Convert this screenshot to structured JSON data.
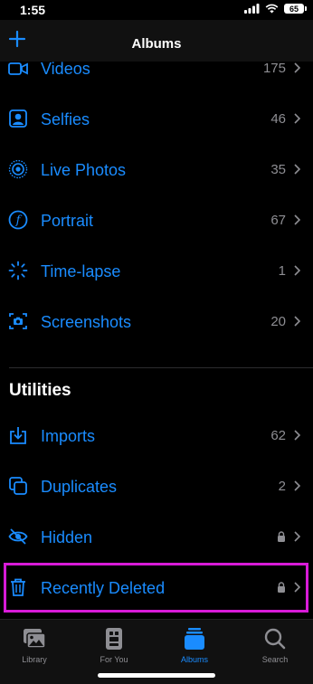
{
  "status": {
    "time": "1:55",
    "battery": "65"
  },
  "nav": {
    "title": "Albums"
  },
  "media_types": [
    {
      "label": "Videos",
      "count": "175",
      "icon": "video-icon"
    },
    {
      "label": "Selfies",
      "count": "46",
      "icon": "selfie-icon"
    },
    {
      "label": "Live Photos",
      "count": "35",
      "icon": "live-photo-icon"
    },
    {
      "label": "Portrait",
      "count": "67",
      "icon": "portrait-icon"
    },
    {
      "label": "Time-lapse",
      "count": "1",
      "icon": "timelapse-icon"
    },
    {
      "label": "Screenshots",
      "count": "20",
      "icon": "screenshot-icon"
    }
  ],
  "utilities": {
    "title": "Utilities",
    "items": [
      {
        "label": "Imports",
        "count": "62",
        "icon": "import-icon"
      },
      {
        "label": "Duplicates",
        "count": "2",
        "icon": "duplicates-icon"
      },
      {
        "label": "Hidden",
        "locked": true,
        "icon": "hidden-icon"
      },
      {
        "label": "Recently Deleted",
        "locked": true,
        "icon": "trash-icon"
      }
    ]
  },
  "tabs": [
    {
      "label": "Library",
      "icon": "library-icon",
      "active": false
    },
    {
      "label": "For You",
      "icon": "for-you-icon",
      "active": false
    },
    {
      "label": "Albums",
      "icon": "albums-icon",
      "active": true
    },
    {
      "label": "Search",
      "icon": "search-icon",
      "active": false
    }
  ],
  "colors": {
    "accent": "#1a8cff",
    "highlight": "#d81bd8",
    "secondary": "#8e8e93"
  }
}
